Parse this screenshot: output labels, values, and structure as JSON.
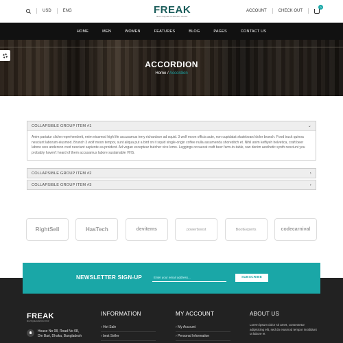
{
  "topbar": {
    "currency": "USD",
    "language": "ENG",
    "account": "ACCOUNT",
    "checkout": "CHECK OUT",
    "cart_count": "0"
  },
  "logo": {
    "name": "FREAK",
    "tagline": "BOUTIQUE FASHION SHOP"
  },
  "nav": [
    "HOME",
    "MEN",
    "WOMEN",
    "FEATURES",
    "BLOG",
    "PAGES",
    "CONTACT US"
  ],
  "hero": {
    "title": "ACCORDION",
    "crumb_home": "Home",
    "crumb_sep": " / ",
    "crumb_current": "Accordion"
  },
  "accordion": [
    {
      "title": "COLLAPSIBLE GROUP ITEM #1",
      "body": "Anim pariatur cliche reprehenderit, enim eiusmod high life accusamus terry richardson ad squid. 3 wolf moon officia aute, non cupidatat skateboard dolor brunch. Food truck quinoa nesciunt laborum eiusmod. Brunch 3 wolf moon tempor, sunt aliqua put a bird on it squid single-origin coffee nulla assumenda shoreditch et. Nihil anim keffiyeh helvetica, craft beer labore wes anderson cred nesciunt sapiente ea proident. Ad vegan excepteur butcher vice lomo. Leggings occaecat craft beer farm-to-table, raw denim aesthetic synth nesciunt you probably haven't heard of them accusamus labore sustainable VHS.",
      "chevron": "⌄"
    },
    {
      "title": "COLLAPSIBLE GROUP ITEM #2",
      "chevron": "›"
    },
    {
      "title": "COLLAPSIBLE GROUP ITEM #3",
      "chevron": "›"
    }
  ],
  "brands": [
    "RightSell",
    "HasTech",
    "devitems",
    "powerboost",
    "BootExperts",
    "codecarnival"
  ],
  "newsletter": {
    "label": "NEWSLETTER SIGN-UP",
    "placeholder": "Enter your email address...",
    "button": "SUBSCRIBE"
  },
  "footer": {
    "logo_name": "FREAK",
    "logo_tag": "BOUTIQUE FASHION SHOP",
    "address_line1": "House No 08, Road No 08,",
    "address_line2": "Din Bari, Dhaka, Bangladesh",
    "info_heading": "INFORMATION",
    "info_items": [
      "Hot Sale",
      "best Seller"
    ],
    "account_heading": "MY ACCOUNT",
    "account_items": [
      "My Account",
      "Personal Information"
    ],
    "about_heading": "ABOUT US",
    "about_text": "Lorem ipsum dolor sit amet, consectetur adipisicing elit, sed do eiusmod tempor incididunt ut labore et"
  }
}
